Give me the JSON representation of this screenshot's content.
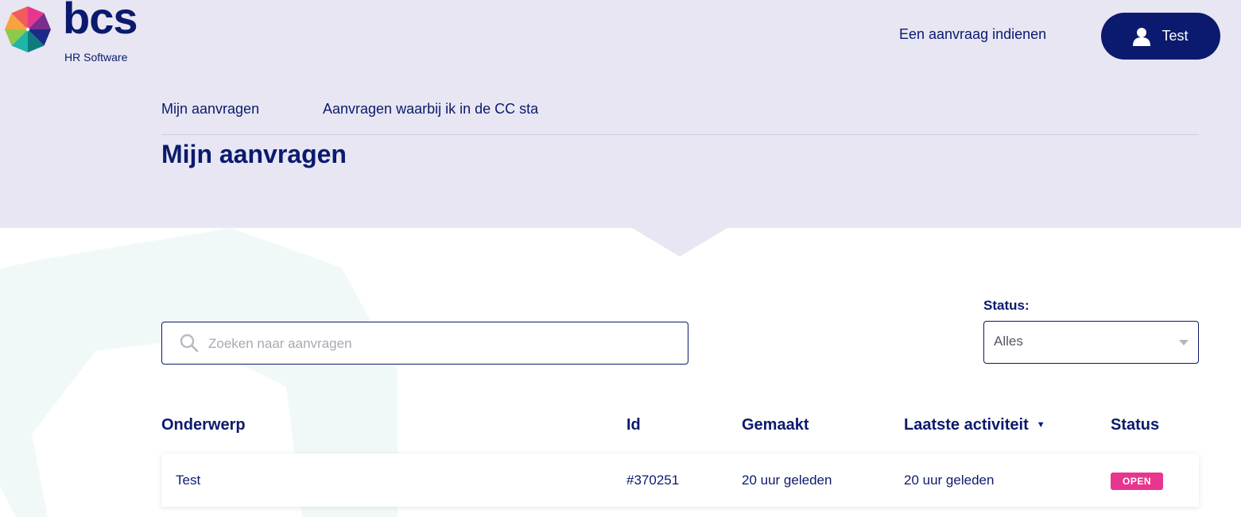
{
  "brand": {
    "name": "bcs",
    "tagline": "HR Software"
  },
  "topnav": {
    "submit_request": "Een aanvraag indienen",
    "user_name": "Test",
    "user_icon": "user-icon"
  },
  "tabs": [
    {
      "label": "Mijn aanvragen"
    },
    {
      "label": "Aanvragen waarbij ik in de CC sta"
    }
  ],
  "page": {
    "title": "Mijn aanvragen"
  },
  "search": {
    "placeholder": "Zoeken naar aanvragen",
    "value": "",
    "icon": "search-icon"
  },
  "filter": {
    "label": "Status:",
    "selected": "Alles"
  },
  "table": {
    "columns": {
      "subject": "Onderwerp",
      "id": "Id",
      "created": "Gemaakt",
      "last_activity": "Laatste activiteit",
      "status": "Status"
    },
    "sort_indicator": "▼",
    "rows": [
      {
        "subject": "Test",
        "id": "#370251",
        "created": "20 uur geleden",
        "last_activity": "20 uur geleden",
        "status": "OPEN"
      }
    ]
  },
  "colors": {
    "primary": "#0b1a6e",
    "hero_bg": "#e7e6f2",
    "status_open": "#e8368f"
  }
}
